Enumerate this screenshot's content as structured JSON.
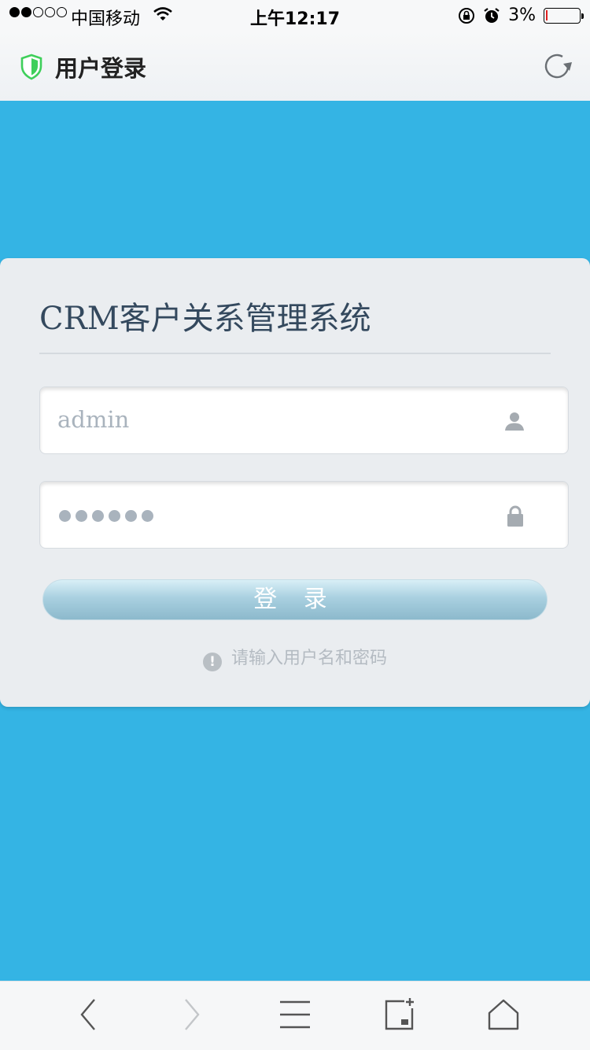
{
  "status_bar": {
    "carrier": "中国移动",
    "time": "上午12:17",
    "battery": "3%",
    "signal_bars_filled": 2,
    "signal_bars_total": 5
  },
  "nav": {
    "title": "用户登录",
    "shield_icon": "shield-icon",
    "refresh_icon": "refresh-icon"
  },
  "login": {
    "heading": "CRM客户关系管理系统",
    "username_value": "admin",
    "password_mask_length": 6,
    "submit_label": "登 录",
    "hint": "请输入用户名和密码"
  },
  "toolbar": {
    "items": [
      "back-icon",
      "forward-icon",
      "menu-icon",
      "tabs-icon",
      "home-icon"
    ]
  },
  "colors": {
    "background": "#34b4e4",
    "card": "#eaedf0",
    "heading": "#34495e",
    "shield": "#3ecf5a"
  }
}
